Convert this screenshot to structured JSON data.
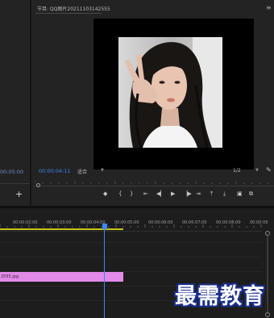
{
  "program_monitor": {
    "title": "节目: QQ图片20211103142555",
    "current_time": "00:00:04:11",
    "fit_option": "适合",
    "resolution_option": "1/2"
  },
  "source_panel": {
    "time": "00:05:00",
    "add_label": "+"
  },
  "transport": {
    "marker": "◆",
    "in_point": "{",
    "out_point": "}",
    "go_in": "⇤",
    "step_back": "◀▏",
    "play": "▶",
    "step_forward": "▕▶",
    "go_out": "⇥",
    "lift": "⤒",
    "extract": "⤓",
    "camera": "▣",
    "compare": "⧉"
  },
  "timeline": {
    "ruler_labels": [
      "00:00:02:00",
      "00:00:03:00",
      "00:00:04:00",
      "00:00:05:00",
      "00:00:06:00",
      "00:00:07:00",
      "00:00:08:00",
      "00:00:09"
    ],
    "clip_label": "2555.jpg"
  },
  "watermark": "最需教育",
  "colors": {
    "accent_blue": "#3d86f4",
    "clip_pink": "#e28ae7",
    "work_area_yellow": "#c8c31a",
    "watermark_outline": "#1b2f8f"
  }
}
